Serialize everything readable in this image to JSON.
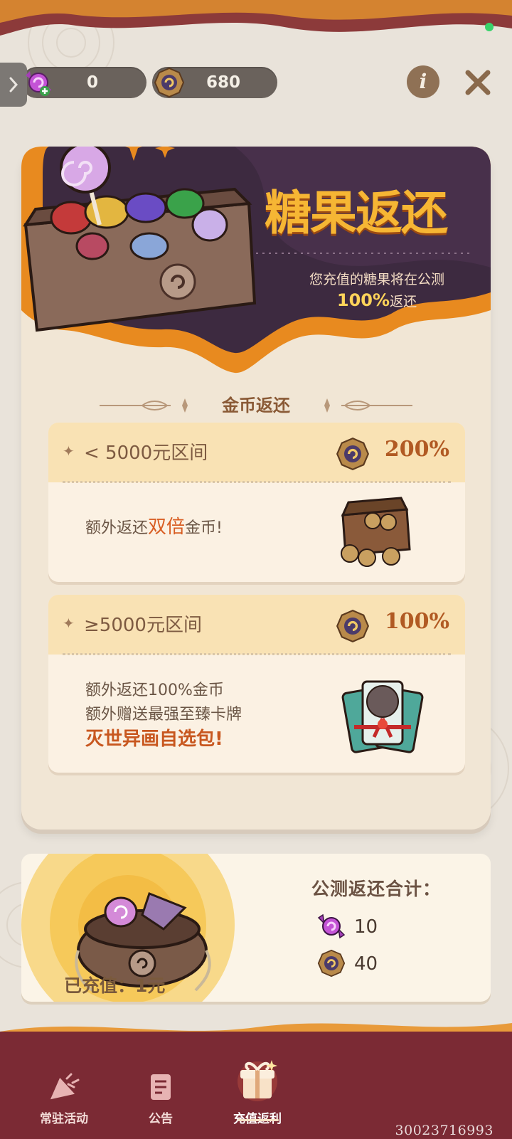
{
  "topbar": {
    "candy_balance": "0",
    "coin_balance": "680"
  },
  "banner": {
    "title": "糖果返还",
    "subtitle_line1": "您充值的糖果将在公测",
    "subtitle_percent": "100%",
    "subtitle_suffix": "返还"
  },
  "section": {
    "title": "金币返还"
  },
  "tiers": [
    {
      "label": "< 5000元区间",
      "percent": "200%",
      "text_prefix": "额外返还",
      "text_highlight": "双倍",
      "text_suffix": "金币!"
    },
    {
      "label": "≥5000元区间",
      "percent": "100%",
      "line1": "额外返还100%金币",
      "line2": "额外赠送最强至臻卡牌",
      "line3": "灭世异画自选包!"
    }
  ],
  "summary": {
    "title": "公测返还合计：",
    "candy_total": "10",
    "coin_total": "40",
    "charged_label": "已充值：1元"
  },
  "nav": {
    "items": [
      {
        "label": "常驻活动",
        "icon": "party-popper-icon"
      },
      {
        "label": "公告",
        "icon": "document-icon"
      },
      {
        "label": "充值返利",
        "icon": "gift-box-icon"
      }
    ],
    "active_index": 2
  },
  "watermark": "30023716993",
  "colors": {
    "banner_purple": "#3d2a40",
    "banner_orange": "#e88a1f",
    "nav_maroon": "#7b2a34",
    "accent_orange": "#d85d22",
    "tier_header": "#f9e2b4"
  }
}
